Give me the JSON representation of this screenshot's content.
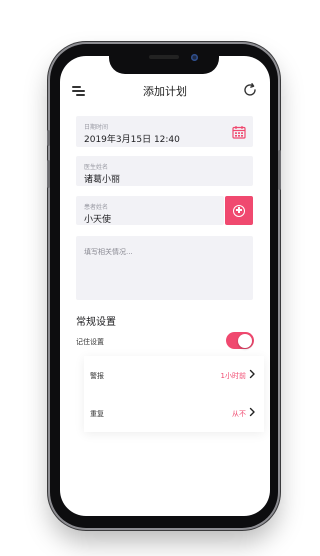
{
  "app": {
    "nav_title": "添加计划"
  },
  "form": {
    "datetime": {
      "label": "日期时间",
      "value": "2019年3月15日 12:40"
    },
    "doctor": {
      "label": "医生姓名",
      "value": "诸葛小丽"
    },
    "patient": {
      "label": "患者姓名",
      "value": "小天使"
    },
    "notes": {
      "placeholder": "填写相关情况..."
    }
  },
  "settings": {
    "section_title": "常规设置",
    "remember_label": "记住设置",
    "remember_on": true,
    "items": [
      {
        "name": "警报",
        "value": "1小时前"
      },
      {
        "name": "重复",
        "value": "从不"
      }
    ]
  },
  "colors": {
    "accent": "#f0496f",
    "field_bg": "#f2f2f6",
    "phone_frame": "#0d0d0f"
  },
  "icons": [
    "menu-icon",
    "refresh-icon",
    "calendar-icon",
    "add-circle-icon",
    "chevron-right-icon"
  ]
}
